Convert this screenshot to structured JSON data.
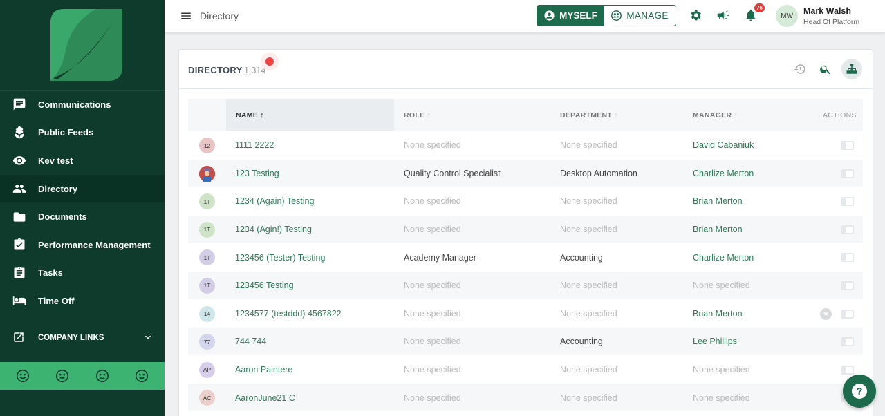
{
  "sidebar": {
    "items": [
      {
        "label": "Communications",
        "icon": "chat-icon"
      },
      {
        "label": "Public Feeds",
        "icon": "feed-icon"
      },
      {
        "label": "Kev test",
        "icon": "eye-icon"
      },
      {
        "label": "Directory",
        "icon": "people-icon"
      },
      {
        "label": "Documents",
        "icon": "folder-icon"
      },
      {
        "label": "Performance Management",
        "icon": "clipboard-check-icon"
      },
      {
        "label": "Tasks",
        "icon": "clipboard-icon"
      },
      {
        "label": "Time Off",
        "icon": "bed-icon"
      }
    ],
    "company_links": "COMPANY LINKS"
  },
  "topbar": {
    "breadcrumb": "Directory",
    "myself": "MYSELF",
    "manage": "MANAGE",
    "notifications": "76",
    "user_initials": "MW",
    "user_name": "Mark Walsh",
    "user_role": "Head Of Platform"
  },
  "directory": {
    "title": "DIRECTORY",
    "count": "1,314",
    "columns": {
      "name": "NAME",
      "role": "ROLE",
      "department": "DEPARTMENT",
      "manager": "MANAGER",
      "actions": "ACTIONS"
    },
    "rows": [
      {
        "initials": "12",
        "avatar_color": "#e8c4c4",
        "name": "1111 2222",
        "role": "None specified",
        "department": "None specified",
        "manager": "David Cabaniuk"
      },
      {
        "initials": "",
        "avatar_color": "#c0504d",
        "name": "123 Testing",
        "role": "Quality Control Specialist",
        "department": "Desktop Automation",
        "manager": "Charlize Merton"
      },
      {
        "initials": "1T",
        "avatar_color": "#cfe3c9",
        "name": "1234 (Again) Testing",
        "role": "None specified",
        "department": "None specified",
        "manager": "Brian Merton"
      },
      {
        "initials": "1T",
        "avatar_color": "#cfe3c9",
        "name": "1234 (Agin!) Testing",
        "role": "None specified",
        "department": "None specified",
        "manager": "Brian Merton"
      },
      {
        "initials": "1T",
        "avatar_color": "#d3cde6",
        "name": "123456 (Tester) Testing",
        "role": "Academy Manager",
        "department": "Accounting",
        "manager": "Charlize Merton"
      },
      {
        "initials": "1T",
        "avatar_color": "#d3cde6",
        "name": "123456 Testing",
        "role": "None specified",
        "department": "None specified",
        "manager": "None specified"
      },
      {
        "initials": "14",
        "avatar_color": "#cfe6ea",
        "name": "1234577 (testddd) 4567822",
        "role": "None specified",
        "department": "None specified",
        "manager": "Brian Merton"
      },
      {
        "initials": "77",
        "avatar_color": "#d3d6ec",
        "name": "744 744",
        "role": "None specified",
        "department": "Accounting",
        "manager": "Lee Phillips"
      },
      {
        "initials": "AP",
        "avatar_color": "#d6cdea",
        "name": "Aaron Paintere",
        "role": "None specified",
        "department": "None specified",
        "manager": "None specified"
      },
      {
        "initials": "AC",
        "avatar_color": "#ecd0cc",
        "name": "AaronJune21 C",
        "role": "None specified",
        "department": "None specified",
        "manager": "None specified"
      }
    ]
  }
}
